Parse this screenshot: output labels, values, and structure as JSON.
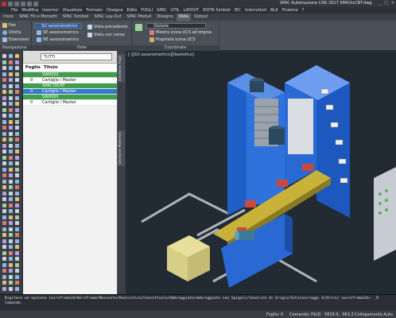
{
  "window": {
    "title": "SPAC Automazione CAD 2017    SPACticCBT.dwg",
    "controls": [
      "_",
      "□",
      "×"
    ]
  },
  "menubar": {
    "items": [
      "File",
      "Modifica",
      "Inserisci",
      "Visualizza",
      "Formato",
      "Disegna",
      "Edita",
      "FOGLI",
      "SPAC",
      "UTIL",
      "LAYOUT",
      "EDITA Simboli",
      "IEC",
      "Interruttori",
      "BLK",
      "Finestra",
      "?"
    ]
  },
  "tabs": {
    "items": [
      "Inizio",
      "SPAC Fili e Morsetti",
      "SPAC Simboli",
      "SPAC Lay-Out",
      "SPAC Moduli",
      "Disegno",
      "Vista",
      "Output"
    ],
    "active": "Vista"
  },
  "ribbon": {
    "navigation": {
      "pan": "Pan",
      "orbit": "Orbita",
      "extents": "Estensioni",
      "label": "Navigazione"
    },
    "views": {
      "current": "SO assonometrico",
      "item2": "SE assonometrico",
      "item3": "NE assonometrico",
      "prev": "Vista precedente",
      "named": "Vista con nome",
      "label": "Viste"
    },
    "coords": {
      "ucs": "Globale",
      "show_icon": "Mostra icona UCS all'origine",
      "props": "Proprietà icona UCS",
      "label": "Coordinate"
    }
  },
  "panel": {
    "filter": "TUTTI",
    "col_sheet": "Foglio",
    "col_title": "Titolo",
    "rows": [
      {
        "sheet": "",
        "title": "SW0001",
        "style": "green"
      },
      {
        "sheet": "0",
        "title": "Cartiglio / Master",
        "style": "white"
      },
      {
        "sheet": "",
        "title": "SPACT0CRT",
        "style": "green"
      },
      {
        "sheet": "0",
        "title": "Cartiglio / Master",
        "style": "blue"
      },
      {
        "sheet": "",
        "title": "SW0001",
        "style": "green"
      },
      {
        "sheet": "0",
        "title": "Cartiglio / Master",
        "style": "white"
      }
    ],
    "vtabs": [
      "Gestione Fogli",
      "Gestione Materiali"
    ]
  },
  "viewport": {
    "label": "[-][SO assonometrico][Realistico]"
  },
  "cmdline": {
    "line1": "Digitare un'opzione [wireframe2d/Wireframe/Nascosto/Realistico/Concettuale/Ombreggiato/ombreggiato con Spigoli/tonalità di Grigio/Schizzo/raggi X/Altro] <wireframe2d>: _R",
    "line2": "Comando:"
  },
  "statusbar": {
    "sheet": "Foglio: 0",
    "command": "Comando: P&ID",
    "coords": "5829.9, -963.2",
    "connection": "Collegamento Auto"
  },
  "colors": {
    "cabinet_blue": "#2f6fd8",
    "tray_yellow": "#c9b23a",
    "floor_box": "#d8cf86",
    "rail_gray": "#b8bec6"
  }
}
